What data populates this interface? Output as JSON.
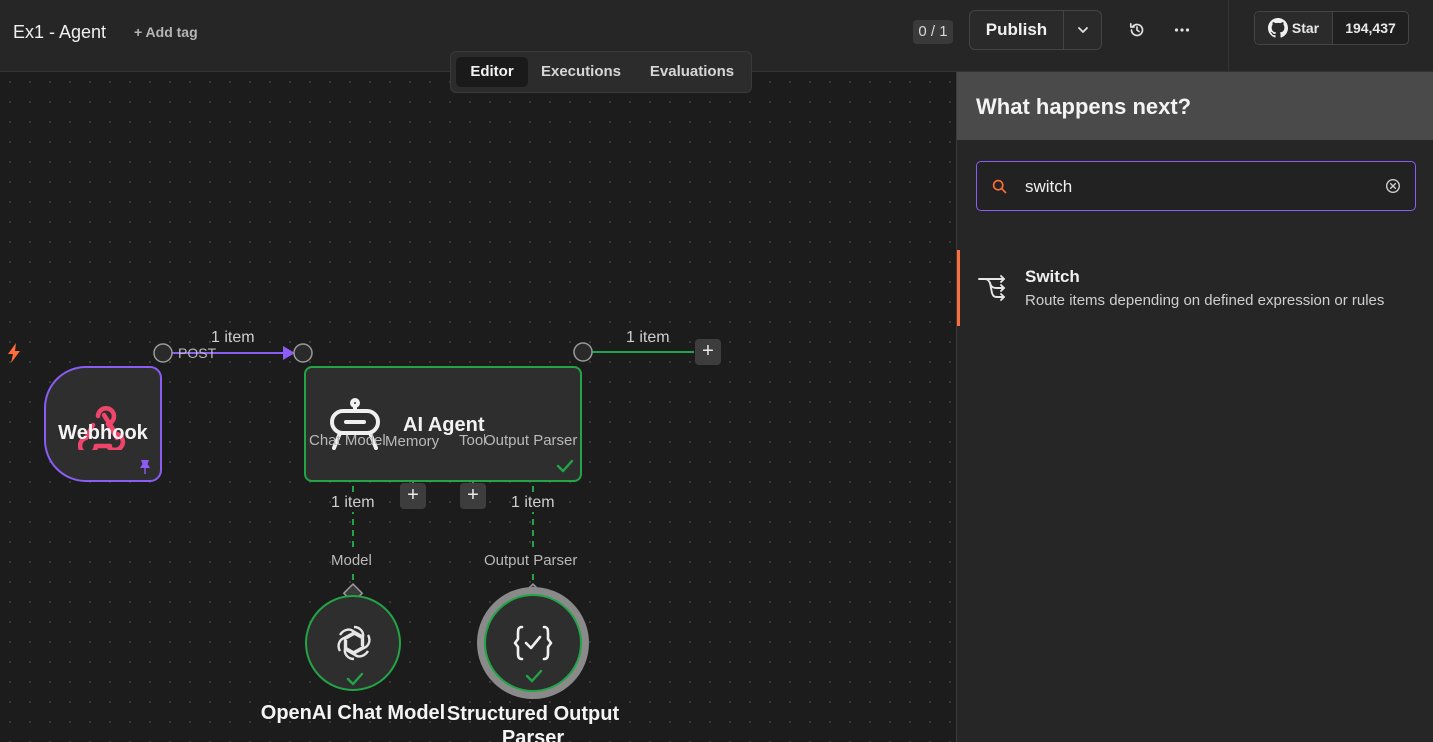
{
  "header": {
    "workflow_title": "Ex1 - Agent",
    "add_tag": "+ Add tag",
    "counter": "0 / 1",
    "publish": "Publish",
    "github_star": "Star",
    "github_count": "194,437"
  },
  "tabs": [
    {
      "label": "Editor",
      "active": true
    },
    {
      "label": "Executions",
      "active": false
    },
    {
      "label": "Evaluations",
      "active": false
    }
  ],
  "workflow": {
    "nodes": {
      "webhook": {
        "label": "Webhook",
        "output_label": "POST",
        "icon": "webhook-icon"
      },
      "agent": {
        "label": "AI Agent",
        "icon": "robot-icon"
      },
      "openai": {
        "label": "OpenAI Chat Model",
        "input_label": "Model",
        "icon": "openai-icon"
      },
      "parser": {
        "label_line1": "Structured Output",
        "label_line2": "Parser",
        "input_label": "Output Parser",
        "icon": "braces-check-icon"
      }
    },
    "connections": {
      "webhook_to_agent": "1 item",
      "agent_output": "1 item",
      "chat_model": "1 item",
      "output_parser": "1 item"
    },
    "agent_ports": [
      "Chat Model",
      "Memory",
      "Tool",
      "Output Parser"
    ],
    "colors": {
      "success": "#22a447",
      "trigger": "#8b5cf6",
      "accent": "#ff6d3a"
    }
  },
  "panel": {
    "title": "What happens next?",
    "search_value": "switch",
    "results": [
      {
        "title": "Switch",
        "description": "Route items depending on defined expression or rules",
        "icon": "switch-icon"
      }
    ]
  }
}
